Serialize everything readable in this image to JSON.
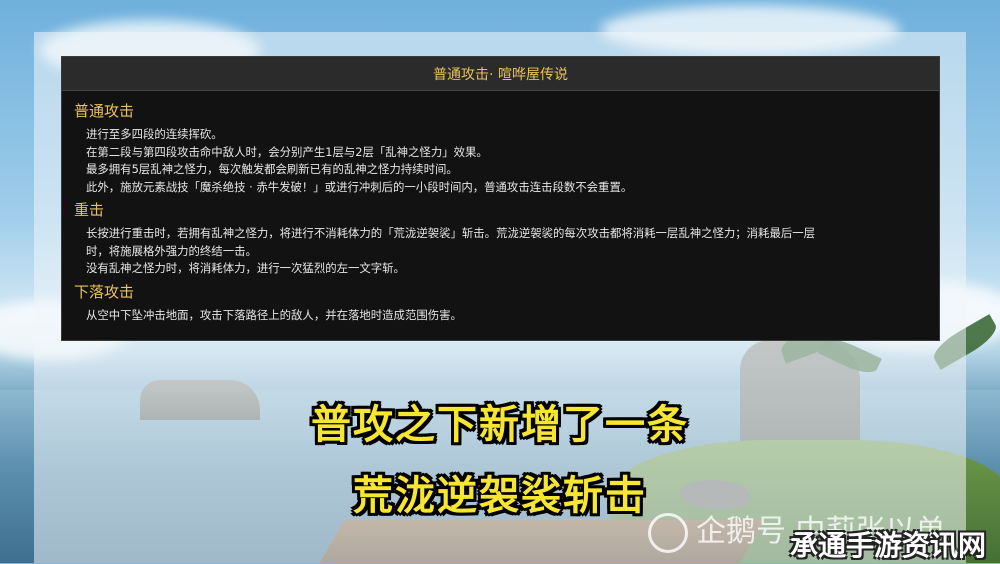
{
  "panel": {
    "title": "普通攻击· 喧哗屋传说",
    "sections": [
      {
        "title": "普通攻击",
        "lines": [
          "进行至多四段的连续挥砍。",
          "在第二段与第四段攻击命中敌人时，会分别产生1层与2层「乱神之怪力」效果。",
          "最多拥有5层乱神之怪力，每次触发都会刷新已有的乱神之怪力持续时间。",
          "此外，施放元素战技「魔杀绝技 · 赤牛发破！」或进行冲刺后的一小段时间内，普通攻击连击段数不会重置。"
        ]
      },
      {
        "title": "重击",
        "lines": [
          "长按进行重击时，若拥有乱神之怪力，将进行不消耗体力的「荒泷逆袈裟」斩击。荒泷逆袈裟的每次攻击都将消耗一层乱神之怪力；消耗最后一层",
          "时，将施展格外强力的终结一击。",
          "没有乱神之怪力时，将消耗体力，进行一次猛烈的左一文字斩。"
        ]
      },
      {
        "title": "下落攻击",
        "lines": [
          "从空中下坠冲击地面，攻击下落路径上的敌人，并在落地时造成范围伤害。"
        ]
      }
    ]
  },
  "captions": {
    "line1": "普攻之下新增了一条",
    "line2": "荒泷逆袈裟斩击"
  },
  "watermarks": {
    "penguin": "企鹅号 中莉张以单",
    "site": "承通手游资讯网"
  },
  "colors": {
    "panel_title": "#e8c25a",
    "caption": "#f7e631",
    "panel_bg": "#121212"
  }
}
